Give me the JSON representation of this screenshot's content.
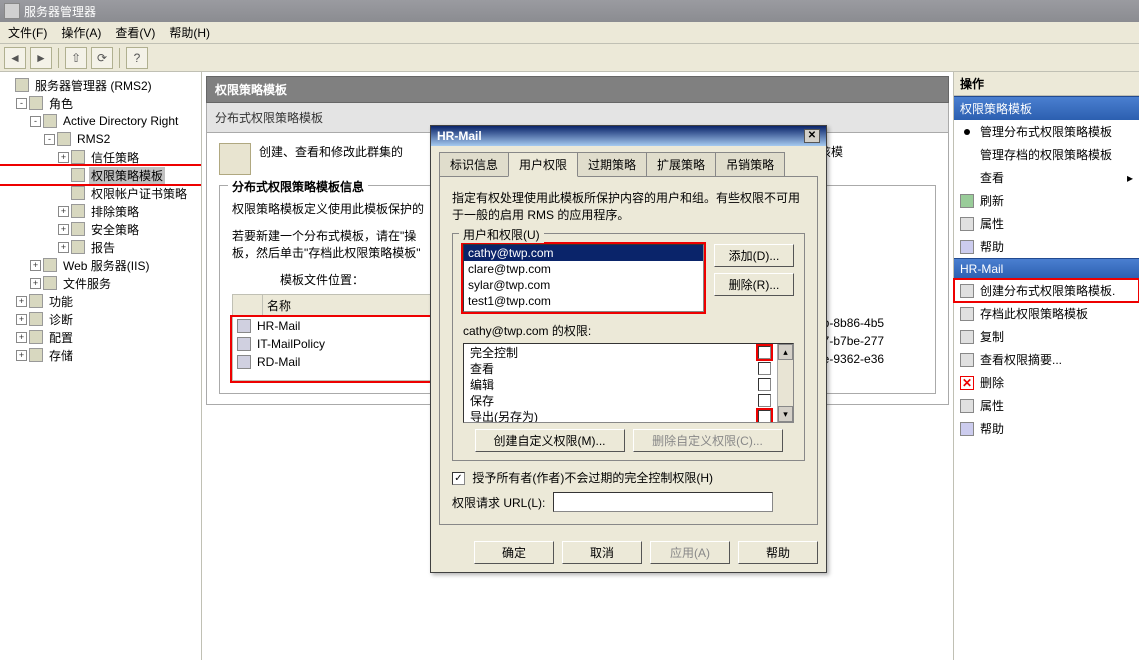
{
  "window": {
    "title": "服务器管理器"
  },
  "menubar": {
    "file": "文件(F)",
    "action": "操作(A)",
    "view": "查看(V)",
    "help": "帮助(H)"
  },
  "tree": {
    "root": "服务器管理器 (RMS2)",
    "roles": "角色",
    "adrms": "Active Directory Right",
    "rms2": "RMS2",
    "trust": "信任策略",
    "policy_templates": "权限策略模板",
    "acct_cert": "权限帐户证书策略",
    "exclude": "排除策略",
    "security": "安全策略",
    "reports": "报告",
    "iis": "Web 服务器(IIS)",
    "fileservice": "文件服务",
    "features": "功能",
    "diag": "诊断",
    "config": "配置",
    "storage": "存储"
  },
  "center": {
    "panel_title": "权限策略模板",
    "panel_subtitle": "分布式权限策略模板",
    "desc": "创建、查看和修改此群集的",
    "group_title": "分布式权限策略模板信息",
    "info_line1": "权限策略模板定义使用此模板保护的",
    "info_line2": "若要新建一个分布式模板，请在\"操",
    "info_line3": "板，然后单击\"存档此权限策略模板\"",
    "template_loc": "模板文件位置：",
    "col_name": "名称",
    "templates": [
      {
        "name": "HR-Mail",
        "guid": "0b-8b86-4b5"
      },
      {
        "name": "IT-MailPolicy",
        "guid": "e7-b7be-277"
      },
      {
        "name": "RD-Mail",
        "guid": "be-9362-e36"
      }
    ],
    "stub_tail": "请选中该模"
  },
  "rightpane": {
    "header": "操作",
    "section1": "权限策略模板",
    "items1": [
      "管理分布式权限策略模板",
      "管理存档的权限策略模板",
      "查看",
      "刷新",
      "属性",
      "帮助"
    ],
    "section2": "HR-Mail",
    "items2": [
      "创建分布式权限策略模板.",
      "存档此权限策略模板",
      "复制",
      "查看权限摘要...",
      "删除",
      "属性",
      "帮助"
    ]
  },
  "dialog": {
    "title": "HR-Mail",
    "tabs": {
      "identify": "标识信息",
      "userperm": "用户权限",
      "expire": "过期策略",
      "extend": "扩展策略",
      "revoke": "吊销策略"
    },
    "instruction": "指定有权处理使用此模板所保护内容的用户和组。有些权限不可用于一般的启用 RMS 的应用程序。",
    "group_users": "用户和权限(U)",
    "users": [
      "cathy@twp.com",
      "clare@twp.com",
      "sylar@twp.com",
      "test1@twp.com"
    ],
    "btn_add": "添加(D)...",
    "btn_remove": "删除(R)...",
    "perm_for": "cathy@twp.com 的权限:",
    "perms": [
      "完全控制",
      "查看",
      "编辑",
      "保存",
      "导出(另存为)"
    ],
    "btn_custom": "创建自定义权限(M)...",
    "btn_delcustom": "删除自定义权限(C)...",
    "grant_owner": "授予所有者(作者)不会过期的完全控制权限(H)",
    "url_label": "权限请求 URL(L):",
    "btn_ok": "确定",
    "btn_cancel": "取消",
    "btn_apply": "应用(A)",
    "btn_help": "帮助"
  }
}
